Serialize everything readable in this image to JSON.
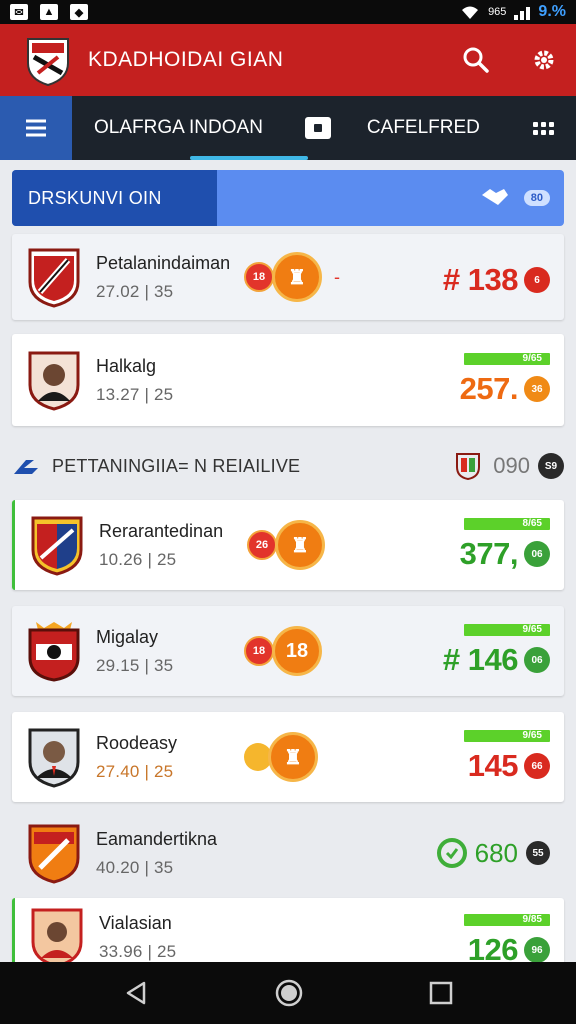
{
  "status_bar": {
    "signal_text": "965",
    "battery": "9.%"
  },
  "app": {
    "title": "KDADHOIDAI GIAN"
  },
  "tabs": {
    "tab1": "OLAFRGA  INDOAN",
    "tab2": "CAFELFRED"
  },
  "section1": {
    "title": "DRSKUNVI OIN",
    "badge": "80"
  },
  "section2": {
    "title": "PETTANINGIIA= N REIAILIVE",
    "count": "090",
    "badge": "S9"
  },
  "rows": [
    {
      "name": "Petalanindaiman",
      "stat": "27.02 | 35",
      "medal_small": "18",
      "score": "# 138",
      "score_badge": "6",
      "green_tag": ""
    },
    {
      "name": "Halkalg",
      "stat": "13.27 | 25",
      "score": "257.",
      "score_badge": "36",
      "green_tag": "9/65"
    },
    {
      "name": "Rerarantedinan",
      "stat": "10.26 | 25",
      "medal_small": "26",
      "score": "377,",
      "score_badge": "06",
      "green_tag": "8/65"
    },
    {
      "name": "Migalay",
      "stat": "29.15 | 35",
      "medal_small": "18",
      "medal_big": "18",
      "score": "# 146",
      "score_badge": "06",
      "green_tag": "9/65"
    },
    {
      "name": "Roodeasy",
      "stat": "27.40 | 25",
      "score": "145",
      "score_badge": "66",
      "green_tag": "9/65"
    },
    {
      "name": "Eamandertikna",
      "stat": "40.20 | 35",
      "score": "680",
      "score_badge": "55"
    },
    {
      "name": "Vialasian",
      "stat": "33.96 | 25",
      "score": "126",
      "score_badge": "96",
      "green_tag": "9/85"
    }
  ],
  "colors": {
    "primary": "#c4201f",
    "tabbar": "#1c232c",
    "accent_blue": "#2b5bb0",
    "green": "#2ea028",
    "red": "#d92a1f"
  }
}
